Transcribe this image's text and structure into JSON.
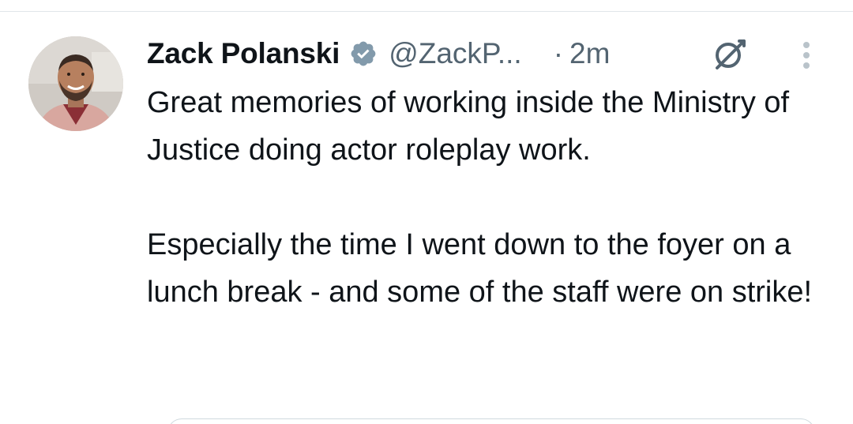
{
  "tweet": {
    "author": {
      "display_name": "Zack Polanski",
      "handle": "@ZackP...",
      "verified": true,
      "avatar_icon": "profile-photo"
    },
    "separator": "·",
    "timestamp": "2m",
    "header_icons": [
      "grok-icon",
      "more-options-icon"
    ],
    "text_paragraphs": [
      "Great memories of working inside the Ministry of Justice doing actor roleplay work.",
      "Especially the time I went down to the foyer on a lunch break - and some of the staff were on strike!"
    ]
  },
  "colors": {
    "primary_text": "#0f1419",
    "secondary_text": "#536471",
    "verified_badge": "#829aab",
    "divider": "#e1e6ea"
  }
}
